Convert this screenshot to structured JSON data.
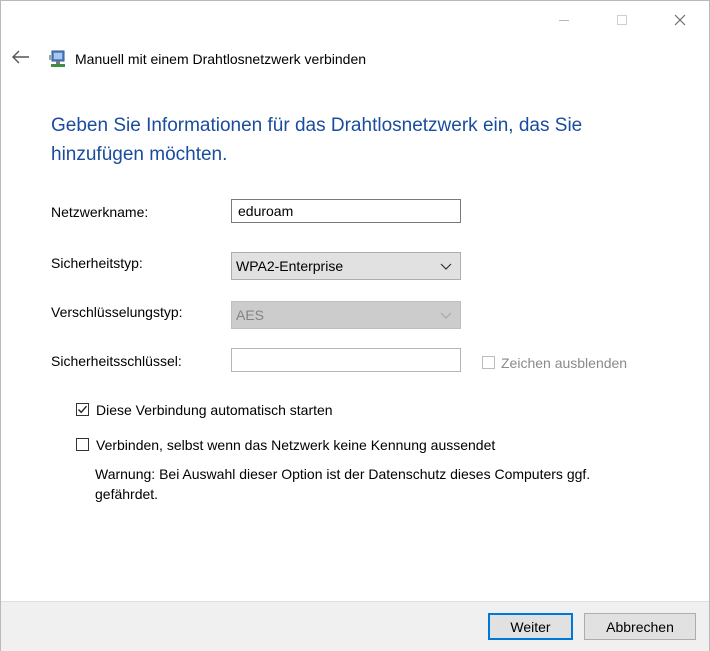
{
  "window": {
    "minimize_icon": "minimize-icon",
    "maximize_icon": "maximize-icon",
    "close_icon": "close-icon"
  },
  "header": {
    "title": "Manuell mit einem Drahtlosnetzwerk verbinden",
    "back_icon": "back-arrow-icon",
    "app_icon": "network-icon"
  },
  "heading": "Geben Sie Informationen für das Drahtlosnetzwerk ein, das Sie hinzufügen möchten.",
  "form": {
    "network_name": {
      "label": "Netzwerkname:",
      "value": "eduroam"
    },
    "security_type": {
      "label": "Sicherheitstyp:",
      "value": "WPA2-Enterprise"
    },
    "encryption_type": {
      "label": "Verschlüsselungstyp:",
      "value": "AES",
      "disabled": true
    },
    "security_key": {
      "label": "Sicherheitsschlüssel:",
      "value": "",
      "hide_chars_label": "Zeichen ausblenden",
      "hide_chars_checked": false,
      "hide_chars_disabled": true
    }
  },
  "options": {
    "auto_start": {
      "label": "Diese Verbindung automatisch starten",
      "checked": true
    },
    "connect_hidden": {
      "label": "Verbinden, selbst wenn das Netzwerk keine Kennung aussendet",
      "checked": false
    },
    "warning": "Warnung: Bei Auswahl dieser Option ist der Datenschutz dieses Computers ggf. gefährdet."
  },
  "buttons": {
    "next": "Weiter",
    "cancel": "Abbrechen"
  },
  "colors": {
    "heading": "#1a4c9e",
    "focus_border": "#0078d7",
    "footer_bg": "#f0f0f0"
  }
}
